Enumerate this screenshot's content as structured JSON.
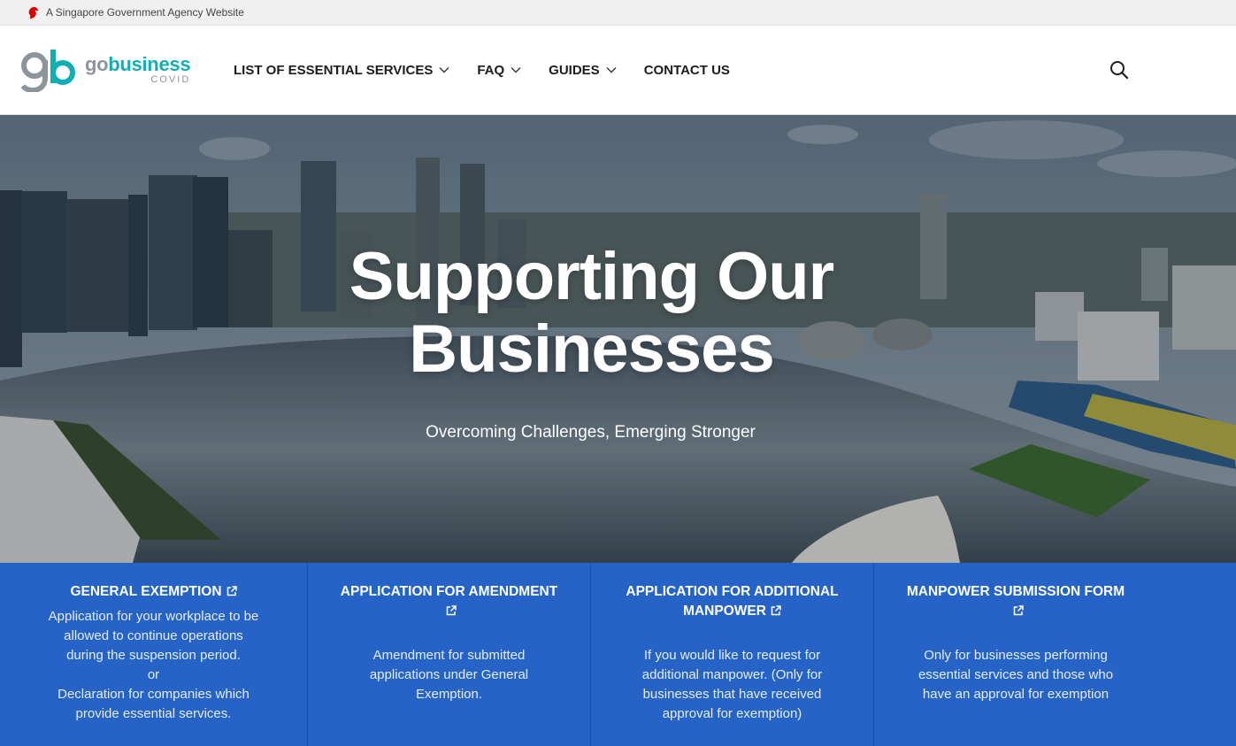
{
  "masthead": {
    "text": "A Singapore Government Agency Website"
  },
  "logo": {
    "go": "go",
    "business": "business",
    "covid": "COVID"
  },
  "nav": {
    "items": [
      {
        "label": "LIST OF ESSENTIAL SERVICES",
        "dropdown": true
      },
      {
        "label": "FAQ",
        "dropdown": true
      },
      {
        "label": "GUIDES",
        "dropdown": true
      },
      {
        "label": "CONTACT US",
        "dropdown": false
      }
    ]
  },
  "hero": {
    "title_line1": "Supporting Our",
    "title_line2": "Businesses",
    "subtitle": "Overcoming Challenges, Emerging Stronger"
  },
  "cards": [
    {
      "title": "GENERAL EXEMPTION",
      "desc_lines": [
        "Application for your workplace to be",
        "allowed to continue operations",
        "during the suspension period.",
        "or",
        "Declaration for companies which",
        "provide essential services."
      ]
    },
    {
      "title": "APPLICATION FOR AMENDMENT",
      "desc_lines": [
        "Amendment for submitted",
        "applications under General",
        "Exemption."
      ]
    },
    {
      "title": "APPLICATION FOR ADDITIONAL MANPOWER",
      "desc_lines": [
        "If you would like to request for",
        "additional manpower. (Only for",
        "businesses that have received",
        "approval for exemption)"
      ]
    },
    {
      "title": "MANPOWER SUBMISSION FORM",
      "desc_lines": [
        "Only for businesses performing",
        "essential services and those who",
        "have an approval for exemption"
      ]
    }
  ],
  "colors": {
    "brand_teal": "#12aeb5",
    "brand_grey": "#8d949b",
    "card_blue": "#2563c6"
  },
  "icons": {
    "masthead": "lion-head-icon",
    "search": "search-icon",
    "external": "external-link-icon",
    "dropdown": "chevron-down-icon"
  }
}
